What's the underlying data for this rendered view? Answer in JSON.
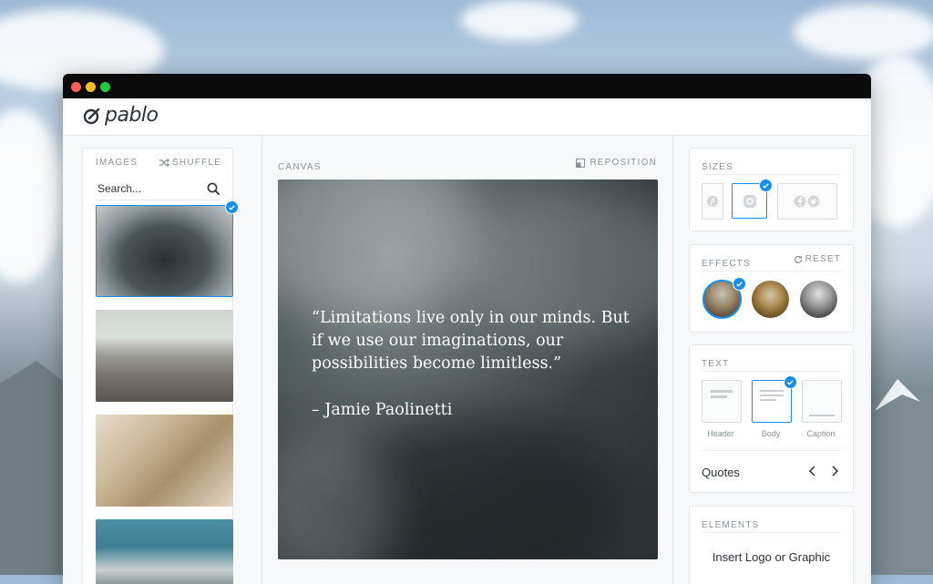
{
  "app": {
    "name": "pablo"
  },
  "window": {
    "dot_colors": [
      "#fe5f57",
      "#febc2e",
      "#28c840"
    ]
  },
  "images_panel": {
    "title": "IMAGES",
    "shuffle_label": "SHUFFLE",
    "search_placeholder": "Search...",
    "thumbnails": [
      {
        "name": "cloud-aerial-thumbnail",
        "selected": true
      },
      {
        "name": "city-skyline-thumbnail",
        "selected": false
      },
      {
        "name": "dry-grass-thumbnail",
        "selected": false
      },
      {
        "name": "blue-wall-thumbnail",
        "selected": false
      }
    ]
  },
  "canvas_panel": {
    "title": "CANVAS",
    "reposition_label": "REPOSITION",
    "quote": "“Limitations live only in our minds. But if we use our imaginations, our possibilities become limitless.”",
    "author": "– Jamie Paolinetti"
  },
  "sizes_panel": {
    "title": "SIZES",
    "options": [
      "pinterest-icon",
      "instagram-icon",
      "facebook-twitter-icon"
    ],
    "selected": "instagram-icon"
  },
  "effects_panel": {
    "title": "EFFECTS",
    "reset_label": "RESET",
    "selected_index": 0
  },
  "text_panel": {
    "title": "TEXT",
    "styles": [
      "Header",
      "Body",
      "Caption"
    ],
    "selected_style": "Body",
    "font_name": "Quotes"
  },
  "elements_panel": {
    "title": "ELEMENTS",
    "insert_label": "Insert Logo or Graphic"
  },
  "colors": {
    "accent": "#168eea"
  }
}
